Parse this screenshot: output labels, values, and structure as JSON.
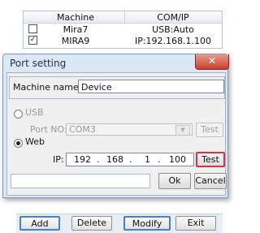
{
  "list": {
    "columns": [
      "Machine",
      "COM/IP"
    ],
    "rows": [
      {
        "checked": false,
        "machine": "Mira7",
        "comip": "USB:Auto"
      },
      {
        "checked": true,
        "machine": "MIRA9",
        "comip": "IP:192.168.1.100"
      }
    ]
  },
  "dialog": {
    "title": "Port setting",
    "close_glyph": "✕",
    "machine_name_label": "Machine name:",
    "machine_name_value": "Device",
    "usb_label": "USB",
    "usb_selected": false,
    "port_no_label": "Port NO:",
    "port_value": "COM3",
    "combo_arrow": "▼",
    "usb_test_label": "Test",
    "web_label": "Web",
    "web_selected": true,
    "ip_label": "IP:",
    "ip_octets": [
      "192",
      "168",
      "1",
      "100"
    ],
    "ip_dot": ".",
    "web_test_label": "Test",
    "ok_label": "Ok",
    "cancel_label": "Cancel"
  },
  "toolbar": {
    "add_label": "Add",
    "delete_label": "Delete",
    "modify_label": "Modify",
    "exit_label": "Exit"
  },
  "colors": {
    "test_highlight": "#d9333f",
    "focus": "#4a7fc4"
  }
}
